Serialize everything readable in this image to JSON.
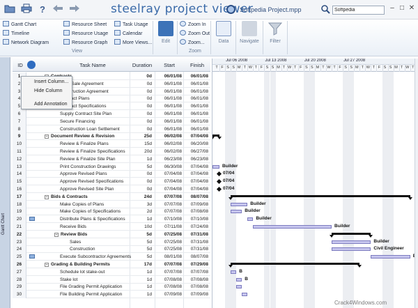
{
  "titlebar": {
    "app_title": "steelray project viewer",
    "project_name": "Softpedia Project.mpp",
    "search_value": "Softpedia",
    "icons": [
      "open-folder-icon",
      "print-icon",
      "help-icon",
      "back-arrow-icon",
      "forward-arrow-icon",
      "search-icon",
      "minimize-icon",
      "maximize-icon",
      "close-icon"
    ]
  },
  "ribbon": {
    "view_items": [
      "Gantt Chart",
      "Timeline",
      "Network Diagram",
      "Resource Sheet",
      "Resource Usage",
      "Resource Graph",
      "Task Usage",
      "Calendar",
      "More Views..."
    ],
    "view_label": "View",
    "edit_label": "Edit",
    "zoom_items": [
      "Zoom In",
      "Zoom Out",
      "Zoom..."
    ],
    "zoom_label": "Zoom",
    "data_label": "Data",
    "navigate_label": "Navigate",
    "filter_label": "Filter"
  },
  "sidebar": {
    "label": "Gantt Chart"
  },
  "grid": {
    "headers": {
      "id": "ID",
      "name": "Task Name",
      "duration": "Duration",
      "start": "Start",
      "finish": "Finish"
    },
    "rows": [
      {
        "id": "1",
        "name": "Contracts",
        "dur": "0d",
        "start": "06/01/08",
        "fin": "06/01/08",
        "sum": true,
        "indent": 0
      },
      {
        "id": "2",
        "name": "Land Sale Agreement",
        "dur": "0d",
        "start": "06/01/08",
        "fin": "06/01/08",
        "sum": false,
        "indent": 1
      },
      {
        "id": "3",
        "name": "Construction Agreement",
        "dur": "0d",
        "start": "06/01/08",
        "fin": "06/01/08",
        "sum": false,
        "indent": 1
      },
      {
        "id": "4",
        "name": "Contract Plans",
        "dur": "0d",
        "start": "06/01/08",
        "fin": "06/01/08",
        "sum": false,
        "indent": 1
      },
      {
        "id": "5",
        "name": "Contract Specifications",
        "dur": "0d",
        "start": "06/01/08",
        "fin": "06/01/08",
        "sum": false,
        "indent": 1
      },
      {
        "id": "6",
        "name": "Supply Contract Site Plan",
        "dur": "0d",
        "start": "06/01/08",
        "fin": "06/01/08",
        "sum": false,
        "indent": 1
      },
      {
        "id": "7",
        "name": "Secure Financing",
        "dur": "0d",
        "start": "06/01/08",
        "fin": "06/01/08",
        "sum": false,
        "indent": 1
      },
      {
        "id": "8",
        "name": "Construction Loan Settlement",
        "dur": "0d",
        "start": "06/01/08",
        "fin": "06/01/08",
        "sum": false,
        "indent": 1
      },
      {
        "id": "9",
        "name": "Document Review & Revision",
        "dur": "25d",
        "start": "06/02/08",
        "fin": "07/04/08",
        "sum": true,
        "indent": 0
      },
      {
        "id": "10",
        "name": "Review & Finalize Plans",
        "dur": "15d",
        "start": "06/02/08",
        "fin": "06/20/08",
        "sum": false,
        "indent": 1
      },
      {
        "id": "11",
        "name": "Review & Finalize Specifications",
        "dur": "20d",
        "start": "06/02/08",
        "fin": "06/27/08",
        "sum": false,
        "indent": 1
      },
      {
        "id": "12",
        "name": "Review & Finalize Site Plan",
        "dur": "1d",
        "start": "06/23/08",
        "fin": "06/23/08",
        "sum": false,
        "indent": 1
      },
      {
        "id": "13",
        "name": "Print Construction Drawings",
        "dur": "5d",
        "start": "06/30/08",
        "fin": "07/04/08",
        "sum": false,
        "indent": 1
      },
      {
        "id": "14",
        "name": "Approve Revised Plans",
        "dur": "0d",
        "start": "07/04/08",
        "fin": "07/04/08",
        "sum": false,
        "indent": 1
      },
      {
        "id": "15",
        "name": "Approve Revised Specifications",
        "dur": "0d",
        "start": "07/04/08",
        "fin": "07/04/08",
        "sum": false,
        "indent": 1
      },
      {
        "id": "16",
        "name": "Approve Revised Site Plan",
        "dur": "0d",
        "start": "07/04/08",
        "fin": "07/04/08",
        "sum": false,
        "indent": 1
      },
      {
        "id": "17",
        "name": "Bids & Contracts",
        "dur": "24d",
        "start": "07/07/08",
        "fin": "08/07/08",
        "sum": true,
        "indent": 0
      },
      {
        "id": "18",
        "name": "Make Copies of Plans",
        "dur": "3d",
        "start": "07/07/08",
        "fin": "07/09/08",
        "sum": false,
        "indent": 1
      },
      {
        "id": "19",
        "name": "Make Copies of Specifications",
        "dur": "2d",
        "start": "07/07/08",
        "fin": "07/08/08",
        "sum": false,
        "indent": 1
      },
      {
        "id": "20",
        "name": "Distribute Plans & Specifications",
        "dur": "1d",
        "start": "07/10/08",
        "fin": "07/10/08",
        "sum": false,
        "indent": 1
      },
      {
        "id": "21",
        "name": "Receive Bids",
        "dur": "10d",
        "start": "07/11/08",
        "fin": "07/24/08",
        "sum": false,
        "indent": 1
      },
      {
        "id": "22",
        "name": "Review Bids",
        "dur": "5d",
        "start": "07/25/08",
        "fin": "07/31/08",
        "sum": true,
        "indent": 1
      },
      {
        "id": "23",
        "name": "Sales",
        "dur": "5d",
        "start": "07/25/08",
        "fin": "07/31/08",
        "sum": false,
        "indent": 2
      },
      {
        "id": "24",
        "name": "Construction",
        "dur": "5d",
        "start": "07/25/08",
        "fin": "07/31/08",
        "sum": false,
        "indent": 2
      },
      {
        "id": "25",
        "name": "Execute Subcontractor Agreements",
        "dur": "5d",
        "start": "08/01/08",
        "fin": "08/07/08",
        "sum": false,
        "indent": 1
      },
      {
        "id": "26",
        "name": "Grading & Building Permits",
        "dur": "17d",
        "start": "07/07/08",
        "fin": "07/29/08",
        "sum": true,
        "indent": 0
      },
      {
        "id": "27",
        "name": "Schedule lot stake-out",
        "dur": "1d",
        "start": "07/07/08",
        "fin": "07/07/08",
        "sum": false,
        "indent": 1
      },
      {
        "id": "28",
        "name": "Stake lot",
        "dur": "1d",
        "start": "07/08/08",
        "fin": "07/08/08",
        "sum": false,
        "indent": 1
      },
      {
        "id": "29",
        "name": "File Grading Permit Application",
        "dur": "1d",
        "start": "07/08/08",
        "fin": "07/08/08",
        "sum": false,
        "indent": 1
      },
      {
        "id": "30",
        "name": "File Building Permit Application",
        "dur": "1d",
        "start": "07/09/08",
        "fin": "07/09/08",
        "sum": false,
        "indent": 1
      }
    ]
  },
  "context_menu": [
    "Insert Column...",
    "Hide Column",
    "Add Annotation"
  ],
  "timescale": {
    "weeks": [
      "Jul 06 2008",
      "Jul 13 2008",
      "Jul 20 2008",
      "Jul 27 2008"
    ],
    "days": [
      "T",
      "F",
      "S",
      "S",
      "M",
      "T",
      "W",
      "T",
      "F",
      "S",
      "S",
      "M",
      "T",
      "W",
      "T",
      "F",
      "S",
      "S",
      "M",
      "T",
      "W",
      "T",
      "F",
      "S",
      "S",
      "M",
      "T",
      "W",
      "T",
      "F",
      "S",
      "S",
      "M",
      "T",
      "W",
      "T"
    ]
  },
  "gantt_labels": [
    "Builder",
    "07/04",
    "07/04",
    "07/04",
    "Builder",
    "Builder",
    "Builder",
    "Builder",
    "Builder",
    "Civil Engineer",
    "Builder",
    "B",
    "B"
  ],
  "watermark": "Crack4Windows.com",
  "colors": {
    "accent": "#3a6aa8",
    "task_bar": "#c7c6ee",
    "summary_bar": "#111111",
    "weekend": "#eceef2"
  }
}
